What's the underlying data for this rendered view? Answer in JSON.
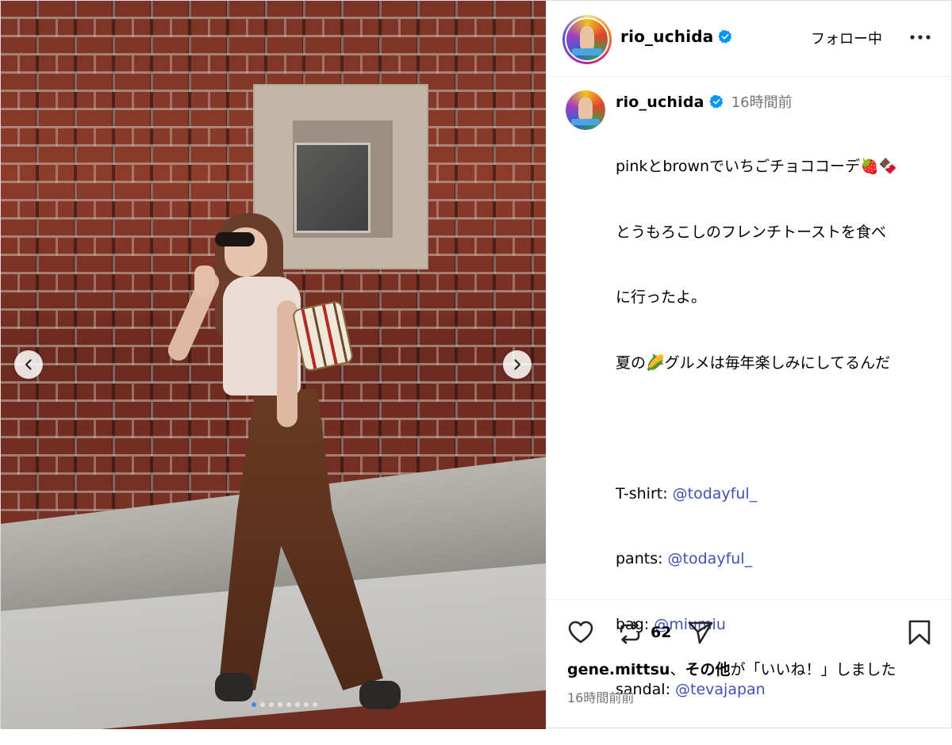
{
  "post": {
    "username": "rio_uchida",
    "follow_label": "フォロー中",
    "time_ago": "16時間前",
    "caption_lines": [
      "pinkとbrownでいちごチョココーデ🍓🍫",
      "とうもろこしのフレンチトーストを食べ",
      "に行ったよ。",
      "夏の🌽グルメは毎年楽しみにしてるんだ",
      ""
    ],
    "credits": [
      {
        "label": "T-shirt:",
        "mention": "@todayful_"
      },
      {
        "label": "pants:",
        "mention": "@todayful_"
      },
      {
        "label": "bag:",
        "mention": "@miumiu"
      },
      {
        "label": "sandal:",
        "mention": "@tevajapan"
      }
    ],
    "repost_count": "62",
    "likes": {
      "user": "gene.mittsu",
      "separator": "、",
      "others": "その他",
      "suffix": "が「いいね！」しました"
    },
    "posted_ago": "16時間前前"
  },
  "carousel": {
    "total": 8,
    "current": 1
  },
  "icons": {
    "verified": "verified-badge-icon",
    "more": "more-options-icon",
    "like": "heart-icon",
    "repost": "repost-icon",
    "share": "send-icon",
    "save": "bookmark-icon",
    "prev": "chevron-left-icon",
    "next": "chevron-right-icon"
  },
  "colors": {
    "verified": "#0095f6",
    "mention": "#4150b4",
    "secondary_text": "#737373",
    "dot_active": "#3a8dff"
  }
}
